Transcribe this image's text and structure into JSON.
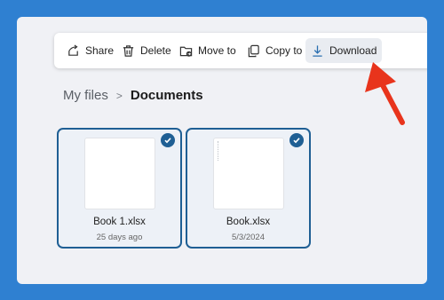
{
  "toolbar": {
    "items": [
      {
        "label": "Share",
        "icon": "share-icon"
      },
      {
        "label": "Delete",
        "icon": "trash-icon"
      },
      {
        "label": "Move to",
        "icon": "move-folder-icon"
      },
      {
        "label": "Copy to",
        "icon": "copy-icon"
      },
      {
        "label": "Download",
        "icon": "download-icon",
        "highlighted": true
      }
    ]
  },
  "breadcrumb": {
    "root": "My files",
    "separator": ">",
    "current": "Documents"
  },
  "files": [
    {
      "name": "Book 1.xlsx",
      "date": "25 days ago",
      "selected": true
    },
    {
      "name": "Book.xlsx",
      "date": "5/3/2024",
      "selected": true
    }
  ],
  "colors": {
    "background": "#2f80d1",
    "selection": "#1f5f94",
    "annotation_arrow": "#e8341c"
  }
}
